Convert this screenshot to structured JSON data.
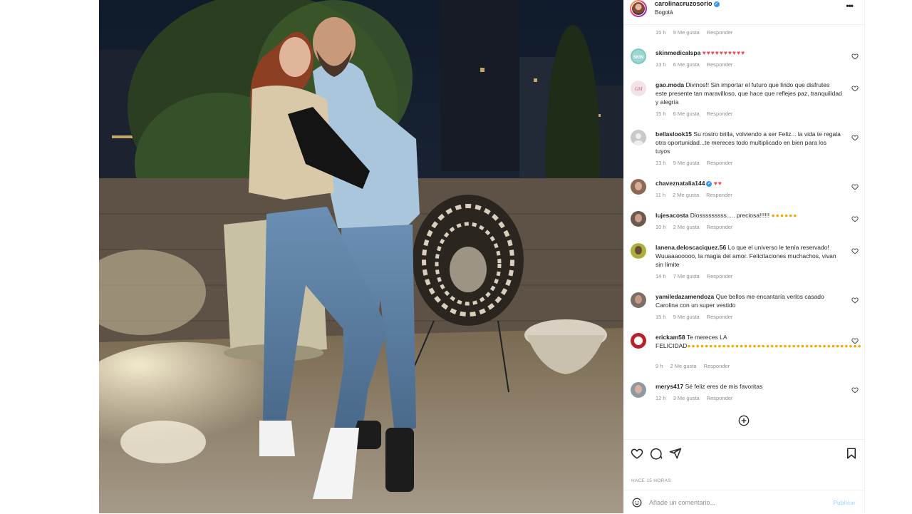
{
  "post": {
    "username": "carolinacruzosorio",
    "location": "Bogotá",
    "verified": true,
    "photo_alt": "Couple embracing on a night rooftop terrace"
  },
  "first_meta": {
    "time": "15 h",
    "likes": "9 Me gusta",
    "reply": "Responder"
  },
  "comments": [
    {
      "user": "skinmedicalspa",
      "text": "",
      "emoji": "♥♥♥♥♥♥♥♥♥♥",
      "time": "13 h",
      "likes": "6 Me gusta",
      "reply": "Responder",
      "avatar_color": "#7cc8c0"
    },
    {
      "user": "gao.moda",
      "text": "Divinos!! Sin importar el futuro que lindo que disfrutes este presente tan maravilloso, que hace que reflejes paz, tranquilidad y alegría",
      "emoji": "",
      "time": "15 h",
      "likes": "6 Me gusta",
      "reply": "Responder",
      "avatar_color": "#f3e3e6"
    },
    {
      "user": "bellaslook15",
      "text": "Su rostro brilla, volviendo a ser Feliz... la vida te regala otra oportunidad...te mereces todo multiplicado en bien para los tuyos",
      "emoji": "",
      "time": "13 h",
      "likes": "9 Me gusta",
      "reply": "Responder",
      "avatar_color": "#c9c9c9"
    },
    {
      "user": "chaveznatalia144",
      "text": "",
      "emoji": "♥♥",
      "time": "11 h",
      "likes": "2 Me gusta",
      "reply": "Responder",
      "avatar_color": "#8a6a55",
      "verified": true
    },
    {
      "user": "lujesacosta",
      "text": "Diosssssssss..... preciosa!!!!!!",
      "emoji": "",
      "time": "10 h",
      "likes": "2 Me gusta",
      "reply": "Responder",
      "avatar_color": "#6b5a50"
    },
    {
      "user": "lanena.deloscaciquez.56",
      "text": "Lo que el universo le tenía reservado! Wuuaaaooooo, la magia del amor. Felicitaciones muchachos, vivan sin límite",
      "emoji": "",
      "time": "14 h",
      "likes": "7 Me gusta",
      "reply": "Responder",
      "avatar_color": "#a7b23b"
    },
    {
      "user": "yamiledazamendoza",
      "text": "Que bellos me encantaría verlos casado Carolina con un super vestido",
      "emoji": "",
      "time": "15 h",
      "likes": "9 Me gusta",
      "reply": "Responder",
      "avatar_color": "#7b6e68"
    },
    {
      "user": "erickam58",
      "text": "Te mereces LA FELICIDAD",
      "emoji": "",
      "time": "9 h",
      "likes": "2 Me gusta",
      "reply": "Responder",
      "avatar_color": "#b8202a"
    },
    {
      "user": "merys417",
      "text": "Sé feliz eres de mis favoritas",
      "emoji": "",
      "time": "12 h",
      "likes": "3 Me gusta",
      "reply": "Responder",
      "avatar_color": "#8e9aa0"
    }
  ],
  "footer": {
    "timestamp": "HACE 15 HORAS",
    "comment_placeholder": "Añade un comentario...",
    "publish_label": "Publicar"
  },
  "icons": {
    "like": "heart-icon",
    "comment": "comment-icon",
    "share": "paper-plane-icon",
    "save": "bookmark-icon",
    "more": "more-options-icon",
    "load_more": "plus-circle-icon",
    "emoji": "emoji-icon"
  },
  "colors": {
    "accent": "#3897f0",
    "heart_red": "#ed4956",
    "meta_gray": "#8e8e8e",
    "publish_disabled": "#b2dffc"
  }
}
